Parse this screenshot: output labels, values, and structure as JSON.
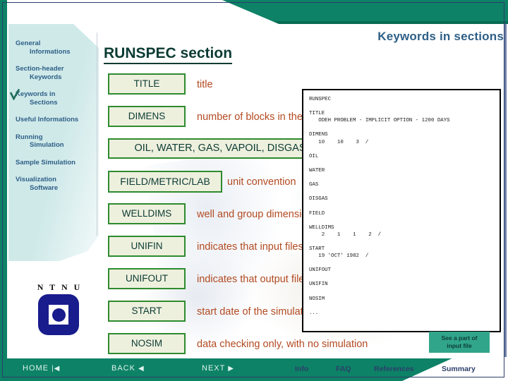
{
  "header": {
    "kicker": "Keywords in sections",
    "section_title": "RUNSPEC section"
  },
  "sidebar": {
    "items": [
      {
        "line1": "General",
        "line2": "Informations",
        "selected": false
      },
      {
        "line1": "Section-header",
        "line2": "Keywords",
        "selected": false
      },
      {
        "line1": "Keywords in",
        "line2": "Sections",
        "selected": true
      },
      {
        "line1": "Useful Informations",
        "line2": "",
        "selected": false
      },
      {
        "line1": "Running",
        "line2": "Simulation",
        "selected": false
      },
      {
        "line1": "Sample Simulation",
        "line2": "",
        "selected": false
      },
      {
        "line1": "Visualization",
        "line2": "Software",
        "selected": false
      }
    ],
    "logo_text": "N T N U"
  },
  "keywords": [
    {
      "name": "TITLE",
      "desc": "title",
      "size": "narrow"
    },
    {
      "name": "DIMENS",
      "desc": "number of blocks in the model",
      "size": "narrow"
    },
    {
      "name": "OIL, WATER, GAS, VAPOIL, DISGAS",
      "desc": "",
      "size": "wide"
    },
    {
      "name": "FIELD/METRIC/LAB",
      "desc": "unit convention",
      "size": "med"
    },
    {
      "name": "WELLDIMS",
      "desc": "well and group dimensions",
      "size": "narrow"
    },
    {
      "name": "UNIFIN",
      "desc": "indicates that input files are unified",
      "size": "narrow"
    },
    {
      "name": "UNIFOUT",
      "desc": "indicates that output files are unified",
      "size": "narrow"
    },
    {
      "name": "START",
      "desc": "start date of the simulation",
      "size": "narrow"
    },
    {
      "name": "NOSIM",
      "desc": "data checking only, with no simulation",
      "size": "narrow"
    }
  ],
  "code_panel": {
    "text": "RUNSPEC\n\nTITLE\n   ODEH PROBLEM - IMPLICIT OPTION - 1200 DAYS\n\nDIMENS\n   10    10    3  /\n\nOIL\n\nWATER\n\nGAS\n\nDISGAS\n\nFIELD\n\nWELLDIMS\n    2    1    1    2  /\n\nSTART\n   19 'OCT' 1982  /\n\nUNIFOUT\n\nUNIFIN\n\nNOSIM\n\n..."
  },
  "see_button": {
    "line1": "See a part of",
    "line2": "input file"
  },
  "footer": {
    "home": "HOME",
    "home_glyph": "|◀",
    "back": "BACK",
    "back_glyph": "◀",
    "next": "NEXT",
    "next_glyph": "▶",
    "links": [
      "Info",
      "FAQ",
      "References",
      "Summary"
    ]
  },
  "colors": {
    "green_bar": "#0d8266",
    "sidebar": "#cfe9e9",
    "nav_text": "#2e5f86",
    "button_border": "#2e8b2e",
    "button_fill": "#eef0de",
    "desc_text": "#b34a21",
    "title_text": "#0b3b33",
    "teal_button": "#31a58a",
    "logo_blue": "#181c8c"
  }
}
